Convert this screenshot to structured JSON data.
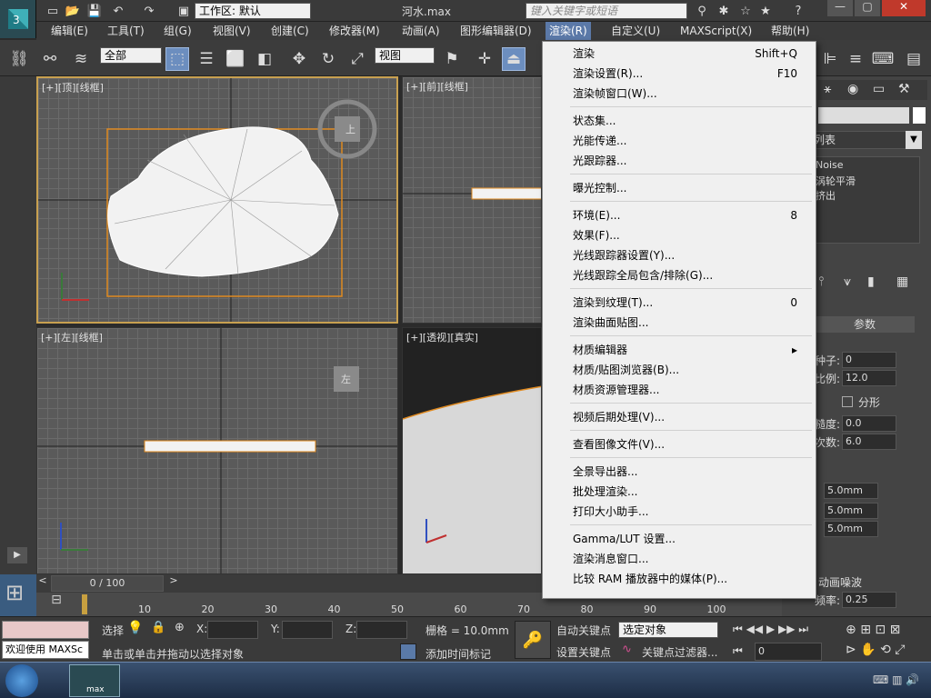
{
  "titlebar": {
    "workspace_label": "工作区: 默认",
    "filename": "河水.max",
    "search_placeholder": "键入关键字或短语"
  },
  "menubar": {
    "items": [
      "编辑(E)",
      "工具(T)",
      "组(G)",
      "视图(V)",
      "创建(C)",
      "修改器(M)",
      "动画(A)",
      "图形编辑器(D)",
      "渲染(R)",
      "自定义(U)",
      "MAXScript(X)",
      "帮助(H)"
    ]
  },
  "toolbar": {
    "selection_filter": "全部",
    "coord_system": "视图"
  },
  "viewports": {
    "top": "[+][顶][线框]",
    "front": "[+][前][线框]",
    "left": "[+][左][线框]",
    "persp": "[+][透视][真实]",
    "viewcube_top": "上",
    "viewcube_left": "左"
  },
  "render_menu": {
    "items": [
      {
        "label": "渲染",
        "shortcut": "Shift+Q"
      },
      {
        "label": "渲染设置(R)...",
        "shortcut": "F10"
      },
      {
        "label": "渲染帧窗口(W)...",
        "shortcut": ""
      },
      {
        "label": "状态集...",
        "shortcut": ""
      },
      {
        "label": "光能传递...",
        "shortcut": ""
      },
      {
        "label": "光跟踪器...",
        "shortcut": ""
      },
      {
        "label": "曝光控制...",
        "shortcut": ""
      },
      {
        "label": "环境(E)...",
        "shortcut": "8"
      },
      {
        "label": "效果(F)...",
        "shortcut": ""
      },
      {
        "label": "光线跟踪器设置(Y)...",
        "shortcut": ""
      },
      {
        "label": "光线跟踪全局包含/排除(G)...",
        "shortcut": ""
      },
      {
        "label": "渲染到纹理(T)...",
        "shortcut": "0"
      },
      {
        "label": "渲染曲面贴图...",
        "shortcut": ""
      },
      {
        "label": "材质编辑器",
        "shortcut": "▸"
      },
      {
        "label": "材质/贴图浏览器(B)...",
        "shortcut": ""
      },
      {
        "label": "材质资源管理器...",
        "shortcut": ""
      },
      {
        "label": "视频后期处理(V)...",
        "shortcut": ""
      },
      {
        "label": "查看图像文件(V)...",
        "shortcut": ""
      },
      {
        "label": "全景导出器...",
        "shortcut": ""
      },
      {
        "label": "批处理渲染...",
        "shortcut": ""
      },
      {
        "label": "打印大小助手...",
        "shortcut": ""
      },
      {
        "label": "Gamma/LUT 设置...",
        "shortcut": ""
      },
      {
        "label": "渲染消息窗口...",
        "shortcut": ""
      },
      {
        "label": "比较 RAM 播放器中的媒体(P)...",
        "shortcut": ""
      }
    ]
  },
  "right_panel": {
    "list_header": "列表",
    "modifier_stack": [
      "Noise",
      "涡轮平滑",
      "挤出"
    ],
    "params_title": "参数",
    "seed_label": "种子:",
    "seed_value": "0",
    "scale_label": "比例:",
    "scale_value": "12.0",
    "fractal_label": "分形",
    "roughness_label": "糙度:",
    "roughness_value": "0.0",
    "iterations_label": "次数:",
    "iterations_value": "6.0",
    "strength_values": [
      "5.0mm",
      "5.0mm",
      "5.0mm"
    ],
    "anim_noise_label": "动画噪波",
    "frequency_label": "频率:",
    "frequency_value": "0.25"
  },
  "timeline": {
    "frame_display": "0 / 100",
    "ticks": [
      "10",
      "20",
      "30",
      "40",
      "50",
      "60",
      "70",
      "80",
      "90",
      "100"
    ]
  },
  "status": {
    "welcome": "欢迎使用 MAXSc",
    "select_label": "选择",
    "x_label": "X:",
    "y_label": "Y:",
    "z_label": "Z:",
    "grid_label": "栅格 = 10.0mm",
    "prompt": "单击或单击并拖动以选择对象",
    "add_time_tag": "添加时间标记",
    "auto_key": "自动关键点",
    "set_key": "设置关键点",
    "key_target": "选定对象",
    "key_filters": "关键点过滤器...",
    "frame_value": "0"
  },
  "taskbar": {
    "app_label": "max"
  },
  "colors": {
    "menu_highlight": "#5b79a8",
    "active_viewport_border": "#c8a050"
  }
}
